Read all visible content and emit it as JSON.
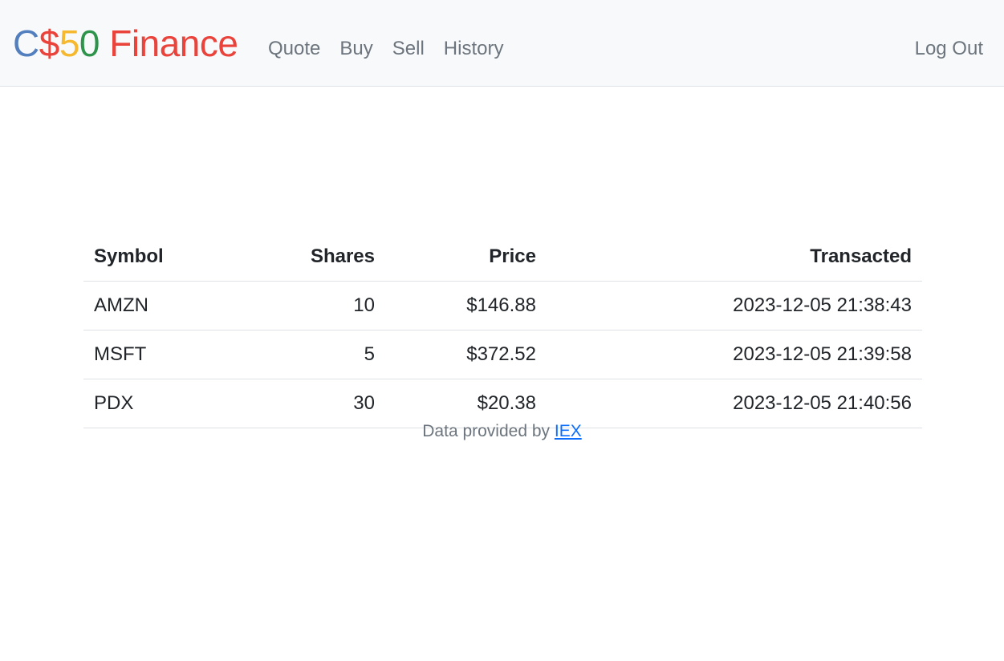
{
  "brand": {
    "parts": [
      "C",
      "$",
      "5",
      "0",
      " Finance"
    ],
    "colors": [
      "#537fbe",
      "#ea433b",
      "#f5b82e",
      "#2e944b",
      "#ea433b"
    ]
  },
  "nav": {
    "quote": "Quote",
    "buy": "Buy",
    "sell": "Sell",
    "history": "History",
    "logout": "Log Out"
  },
  "table": {
    "headers": [
      "Symbol",
      "Shares",
      "Price",
      "Transacted"
    ],
    "rows": [
      [
        "AMZN",
        "10",
        "$146.88",
        "2023-12-05 21:38:43"
      ],
      [
        "MSFT",
        "5",
        "$372.52",
        "2023-12-05 21:39:58"
      ],
      [
        "PDX",
        "30",
        "$20.38",
        "2023-12-05 21:40:56"
      ]
    ]
  },
  "footer": {
    "prefix": "Data provided by",
    "link": "IEX"
  }
}
